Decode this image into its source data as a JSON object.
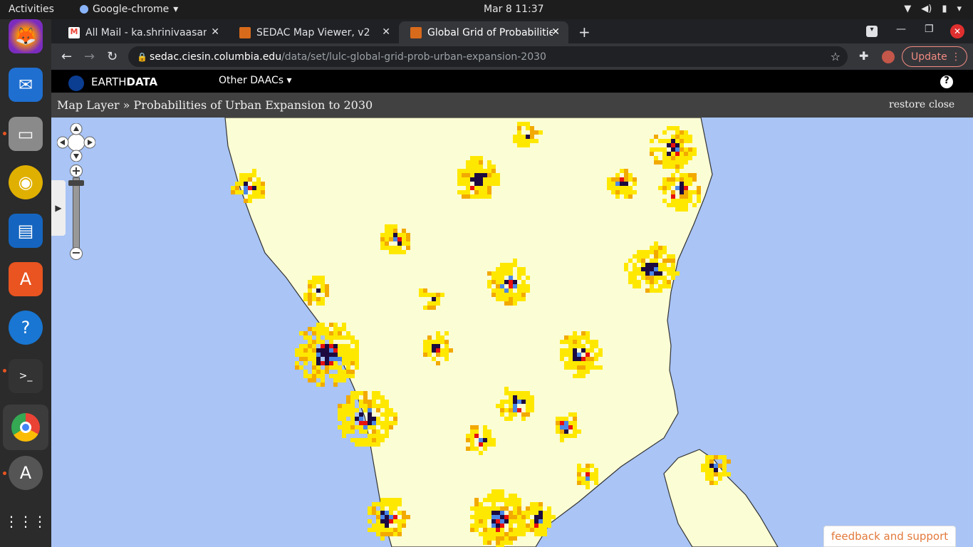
{
  "system": {
    "activities": "Activities",
    "app_name": "Google-chrome",
    "clock": "Mar 8  11:37"
  },
  "dock": {
    "items": [
      "Firefox",
      "Thunderbird",
      "Files",
      "Rhythmbox",
      "LibreOffice Writer",
      "Ubuntu Software",
      "Help",
      "Terminal",
      "Chrome",
      "Software Updater",
      "Show Applications"
    ]
  },
  "browser": {
    "tabs": [
      {
        "title": "All Mail - ka.shrinivaasan@"
      },
      {
        "title": "SEDAC Map Viewer, v2"
      },
      {
        "title": "Global Grid of Probabilitie"
      }
    ],
    "url_host": "sedac.ciesin.columbia.edu",
    "url_path": "/data/set/lulc-global-grid-prob-urban-expansion-2030",
    "update_label": "Update"
  },
  "earthdata": {
    "brand_prefix": "EARTH",
    "brand_suffix": "DATA",
    "other_daacs": "Other DAACs ▾",
    "help": "?"
  },
  "layer": {
    "title": "Map Layer » Probabilities of Urban Expansion to 2030",
    "restore": "restore",
    "close": "close"
  },
  "feedback": "feedback and support",
  "colors": {
    "water": "#a9c4f5",
    "land": "#fbfdd5",
    "low": "#ffe800",
    "mid": "#f2a900",
    "high": "#e8110f",
    "existing": "#1c0a40",
    "blue_cell": "#4a86e8"
  }
}
